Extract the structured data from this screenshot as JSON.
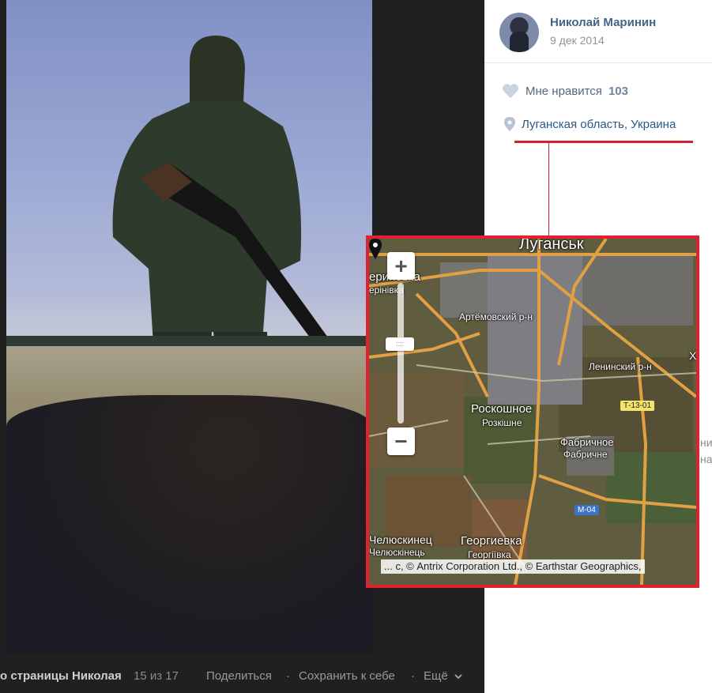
{
  "viewer": {
    "owner_label": "о страницы Николая",
    "counter": "15 из 17",
    "share_label": "Поделиться",
    "separator": "·",
    "save_label": "Сохранить к себе",
    "more_label": "Ещё",
    "more_icon": "chevron-down-icon"
  },
  "post": {
    "author_name": "Николай Маринин",
    "date": "9 дек 2014",
    "likes_label": "Мне нравится",
    "likes_count": "103",
    "location": "Луганская область, Украина",
    "edge_text": [
      "ни",
      "на."
    ]
  },
  "map": {
    "zoom_in_label": "+",
    "zoom_out_label": "−",
    "zoom_handle_grip": "::::",
    "attribution": "... с, © Antrix Corporation Ltd., © Earthstar Geographics,",
    "labels": {
      "lugansk": "Луганськ",
      "perinovka_ru": "еринoвка",
      "perinovka_ua": "ерінівка",
      "artemovsky": "Артёмовский р-н",
      "leninsky": "Ленинский р-н",
      "roskoshnoe_ru": "Роскошное",
      "roskoshnoe_ua": "Розкішне",
      "fabrichnoe_ru": "Фабричное",
      "fabrichnoe_ua": "Фабричне",
      "chelyuskinets_ru": "Челюскинец",
      "chelyuskinets_ua": "Челюскінець",
      "georgievka_ru": "Георгиевка",
      "georgievka_ua": "Георгіївка",
      "edge_x": "Х"
    },
    "routes": {
      "t1301": "Т-13-01",
      "m04": "М-04"
    }
  },
  "colors": {
    "highlight": "#e3202f",
    "link": "#2a5885",
    "author": "#42648b"
  }
}
